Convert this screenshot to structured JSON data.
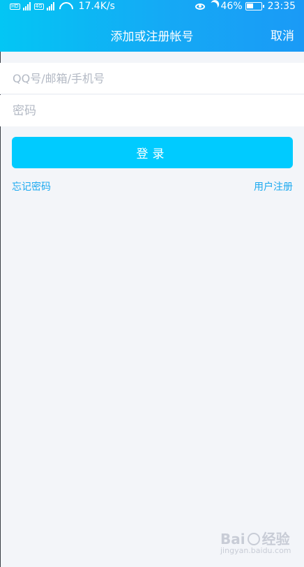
{
  "status_bar": {
    "net_badge_1": "HD",
    "net_badge_2": "4G",
    "speed": "17.4K/s",
    "battery_percent": "46%",
    "battery_level": 0.46,
    "time": "23:35"
  },
  "header": {
    "title": "添加或注册帐号",
    "cancel_label": "取消"
  },
  "form": {
    "account_placeholder": "QQ号/邮箱/手机号",
    "account_value": "",
    "password_placeholder": "密码",
    "password_value": "",
    "login_label": "登录",
    "forgot_label": "忘记密码",
    "register_label": "用户注册"
  },
  "watermark": {
    "brand_a": "Bai",
    "brand_b": "经验",
    "sub": "jingyan.baidu.com"
  },
  "colors": {
    "header_gradient_start": "#03c6f4",
    "header_gradient_end": "#1a9af6",
    "login_button": "#00cbff",
    "link": "#1aa9f0",
    "background": "#f3f5f9"
  }
}
